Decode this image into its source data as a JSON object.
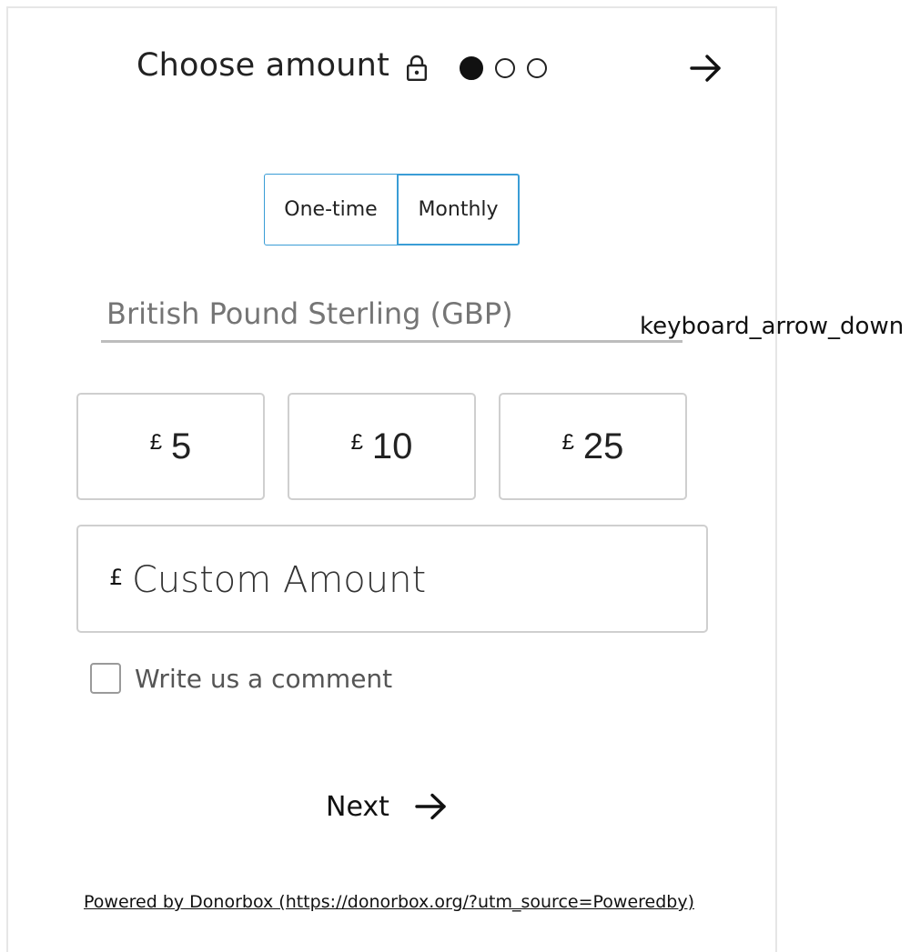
{
  "header": {
    "title": "Choose amount",
    "lock_icon": "lock-icon",
    "steps": {
      "total": 3,
      "current": 1
    },
    "next_icon": "arrow-right-icon"
  },
  "frequency": {
    "options": [
      "One-time",
      "Monthly"
    ],
    "selected": "Monthly",
    "accent_color": "#3a9dd6"
  },
  "currency": {
    "selected": "British Pound Sterling (GBP)",
    "dropdown_icon_text": "keyboard_arrow_down"
  },
  "amounts": {
    "currency_symbol": "£",
    "presets": [
      "5",
      "10",
      "25"
    ],
    "custom_placeholder": "Custom Amount"
  },
  "comment": {
    "label": "Write us a comment",
    "checked": false
  },
  "next": {
    "label": "Next",
    "icon": "arrow-right-icon"
  },
  "footer": {
    "powered_by": "Powered by Donorbox (https://donorbox.org/?utm_source=Poweredby)"
  }
}
